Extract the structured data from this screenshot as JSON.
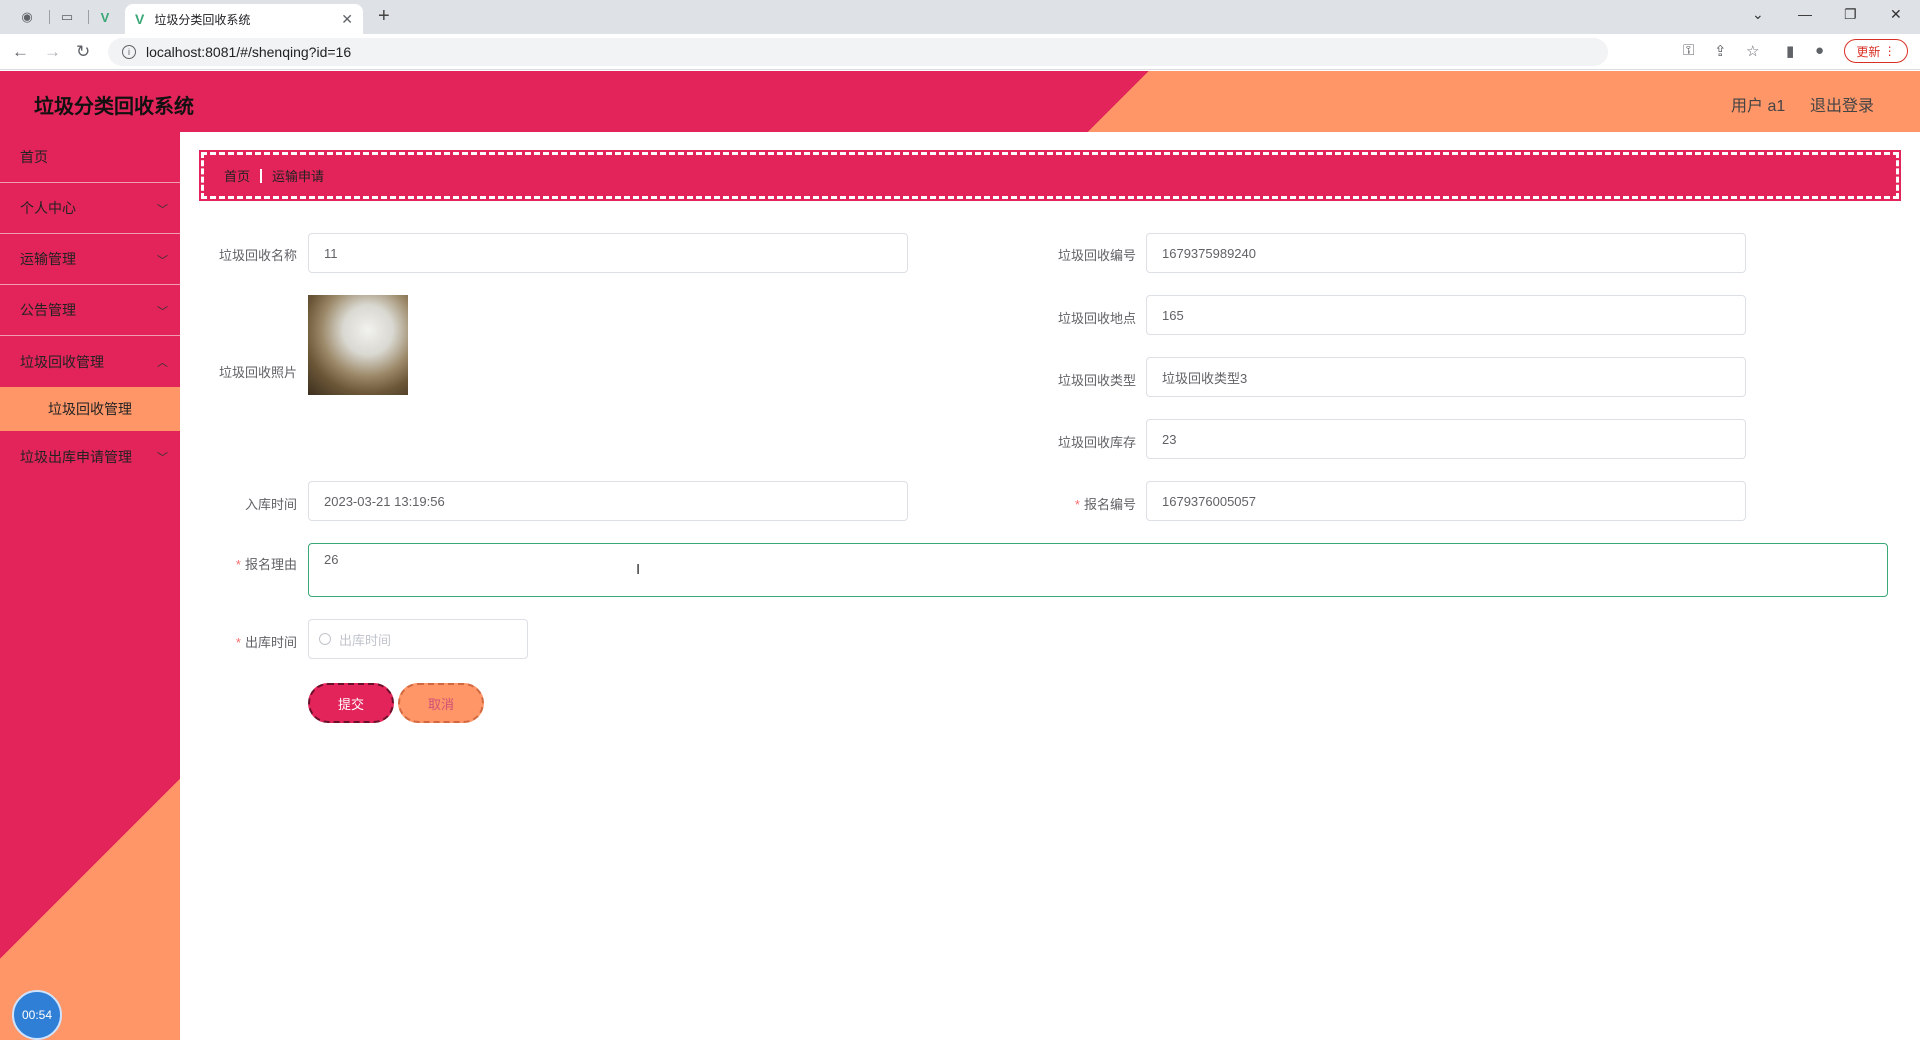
{
  "browser": {
    "tab_title": "垃圾分类回收系统",
    "url": "localhost:8081/#/shenqing?id=16",
    "update_label": "更新"
  },
  "app": {
    "title": "垃圾分类回收系统",
    "user": "用户 a1",
    "logout": "退出登录"
  },
  "sidebar": {
    "items": [
      {
        "label": "首页"
      },
      {
        "label": "个人中心"
      },
      {
        "label": "运输管理"
      },
      {
        "label": "公告管理"
      },
      {
        "label": "垃圾回收管理"
      },
      {
        "label": "垃圾回收管理"
      },
      {
        "label": "垃圾出库申请管理"
      }
    ],
    "timer": "00:54"
  },
  "breadcrumb": {
    "home": "首页",
    "current": "运输申请"
  },
  "form": {
    "name_label": "垃圾回收名称",
    "name_value": "11",
    "code_label": "垃圾回收编号",
    "code_value": "1679375989240",
    "photo_label": "垃圾回收照片",
    "location_label": "垃圾回收地点",
    "location_value": "165",
    "type_label": "垃圾回收类型",
    "type_value": "垃圾回收类型3",
    "stock_label": "垃圾回收库存",
    "stock_value": "23",
    "intime_label": "入库时间",
    "intime_value": "2023-03-21 13:19:56",
    "regno_label": "报名编号",
    "regno_value": "1679376005057",
    "reason_label": "报名理由",
    "reason_value": "26",
    "outtime_label": "出库时间",
    "outtime_placeholder": "出库时间",
    "submit_label": "提交",
    "cancel_label": "取消"
  }
}
